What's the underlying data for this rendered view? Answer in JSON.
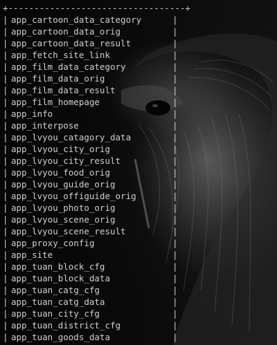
{
  "terminal": {
    "top_border": "+----------------------------------+",
    "rows": [
      "app_cartoon_data_category",
      "app_cartoon_data_orig",
      "app_cartoon_data_result",
      "app_fetch_site_link",
      "app_film_data_category",
      "app_film_data_orig",
      "app_film_data_result",
      "app_film_homepage",
      "app_info",
      "app_interpose",
      "app_lvyou_catagory_data",
      "app_lvyou_city_orig",
      "app_lvyou_city_result",
      "app_lvyou_food_orig",
      "app_lvyou_guide_orig",
      "app_lvyou_offiguide_orig",
      "app_lvyou_photo_orig",
      "app_lvyou_scene_orig",
      "app_lvyou_scene_result",
      "app_proxy_config",
      "app_site",
      "app_tuan_block_cfg",
      "app_tuan_block_data",
      "app_tuan_catg_cfg",
      "app_tuan_catg_data",
      "app_tuan_city_cfg",
      "app_tuan_district_cfg",
      "app_tuan_goods_data"
    ],
    "pipe": "|"
  },
  "colors": {
    "background": "#0a0a0a",
    "text": "#cfcfcf"
  },
  "wallpaper": {
    "subject": "dark creature wallpaper"
  }
}
